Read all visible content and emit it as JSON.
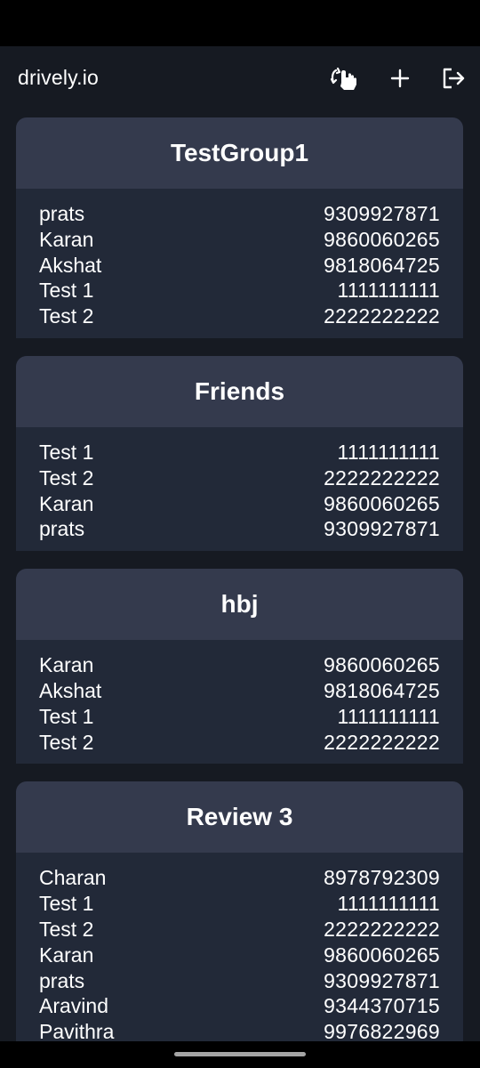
{
  "app": {
    "title": "drively.io"
  },
  "toolbar": {
    "actions": [
      {
        "icon": "tap-swap-icon"
      },
      {
        "icon": "plus-icon"
      },
      {
        "icon": "logout-icon"
      }
    ]
  },
  "groups": [
    {
      "name": "TestGroup1",
      "members": [
        {
          "name": "prats",
          "phone": "9309927871"
        },
        {
          "name": "Karan",
          "phone": "9860060265"
        },
        {
          "name": "Akshat",
          "phone": "9818064725"
        },
        {
          "name": "Test 1",
          "phone": "1111111111"
        },
        {
          "name": "Test 2",
          "phone": "2222222222"
        }
      ]
    },
    {
      "name": "Friends",
      "members": [
        {
          "name": "Test 1",
          "phone": "1111111111"
        },
        {
          "name": "Test 2",
          "phone": "2222222222"
        },
        {
          "name": "Karan",
          "phone": "9860060265"
        },
        {
          "name": "prats",
          "phone": "9309927871"
        }
      ]
    },
    {
      "name": "hbj",
      "members": [
        {
          "name": "Karan",
          "phone": "9860060265"
        },
        {
          "name": "Akshat",
          "phone": "9818064725"
        },
        {
          "name": "Test 1",
          "phone": "1111111111"
        },
        {
          "name": "Test 2",
          "phone": "2222222222"
        }
      ]
    },
    {
      "name": "Review 3",
      "members": [
        {
          "name": "Charan",
          "phone": "8978792309"
        },
        {
          "name": "Test 1",
          "phone": "1111111111"
        },
        {
          "name": "Test 2",
          "phone": "2222222222"
        },
        {
          "name": "Karan",
          "phone": "9860060265"
        },
        {
          "name": "prats",
          "phone": "9309927871"
        },
        {
          "name": "Aravind",
          "phone": "9344370715"
        },
        {
          "name": "Pavithra",
          "phone": "9976822969"
        }
      ]
    }
  ],
  "colors": {
    "background": "#161a22",
    "card_header": "#343a4d",
    "card_body": "#222938",
    "text": "#ffffff"
  }
}
